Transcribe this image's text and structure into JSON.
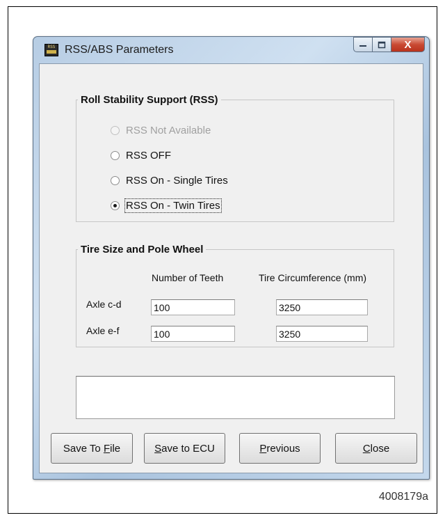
{
  "window": {
    "title": "RSS/ABS Parameters",
    "icon_text": "RSS",
    "close_glyph": "X"
  },
  "rss": {
    "legend": "Roll Stability Support (RSS)",
    "options": [
      {
        "label": "RSS Not Available",
        "selected": false,
        "enabled": false
      },
      {
        "label": "RSS OFF",
        "selected": false,
        "enabled": true
      },
      {
        "label": "RSS On - Single Tires",
        "selected": false,
        "enabled": true
      },
      {
        "label": "RSS On - Twin Tires",
        "selected": true,
        "enabled": true
      }
    ]
  },
  "tire": {
    "legend": "Tire Size and Pole Wheel",
    "col_teeth": "Number of Teeth",
    "col_circ": "Tire Circumference (mm)",
    "axles": [
      {
        "label": "Axle c-d",
        "teeth": "100",
        "circumference": "3250"
      },
      {
        "label": "Axle e-f",
        "teeth": "100",
        "circumference": "3250"
      }
    ]
  },
  "status_text": "",
  "buttons": {
    "save_file_pre": "Save To ",
    "save_file_key": "F",
    "save_file_post": "ile",
    "save_ecu_key": "S",
    "save_ecu_post": "ave to ECU",
    "previous_key": "P",
    "previous_post": "revious",
    "close_key": "C",
    "close_post": "lose"
  },
  "figure_id": "4008179a"
}
